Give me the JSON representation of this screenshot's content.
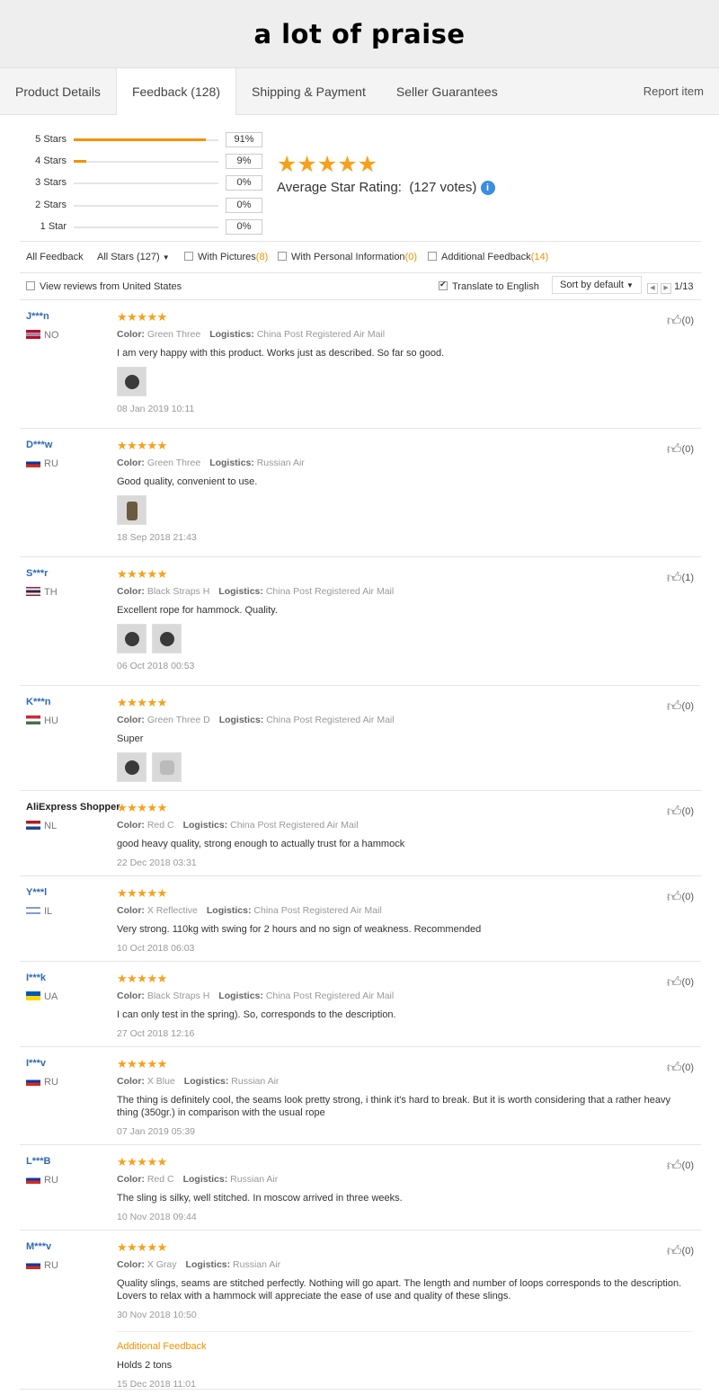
{
  "banner": {
    "title": "a lot of praise"
  },
  "tabs": [
    {
      "label": "Product Details"
    },
    {
      "label": "Feedback (128)"
    },
    {
      "label": "Shipping & Payment"
    },
    {
      "label": "Seller Guarantees"
    }
  ],
  "report_label": "Report item",
  "rating_bars": [
    {
      "label": "5 Stars",
      "pct": "91%",
      "value": 0.91
    },
    {
      "label": "4 Stars",
      "pct": "9%",
      "value": 0.09
    },
    {
      "label": "3 Stars",
      "pct": "0%",
      "value": 0
    },
    {
      "label": "2 Stars",
      "pct": "0%",
      "value": 0
    },
    {
      "label": "1 Star",
      "pct": "0%",
      "value": 0
    }
  ],
  "average": {
    "stars": "★★★★★",
    "label": "Average Star Rating:",
    "votes": "(127 votes)",
    "info_icon": "i"
  },
  "filters": {
    "all_feedback": "All Feedback",
    "all_stars": "All Stars (127)",
    "with_pictures": "With Pictures",
    "with_pictures_count": "(8)",
    "with_personal": "With Personal Information",
    "with_personal_count": "(0)",
    "additional": "Additional Feedback",
    "additional_count": "(14)"
  },
  "sortbar": {
    "view_us": "View reviews from United States",
    "translate": "Translate to English",
    "sort": "Sort by default",
    "page": "1/13"
  },
  "labels": {
    "color": "Color:",
    "logistics": "Logistics:"
  },
  "reviews": [
    {
      "user": "J***n",
      "country": "NO",
      "stars": "★★★★★",
      "color": "Green Three",
      "logistics": "China Post Registered Air Mail",
      "text": "I am very happy with this product. Works just as described. So far so good.",
      "date": "08 Jan 2019 10:11",
      "likes": "(0)"
    },
    {
      "user": "D***w",
      "country": "RU",
      "stars": "★★★★★",
      "color": "Green Three",
      "logistics": "Russian Air",
      "text": "Good quality, convenient to use.",
      "date": "18 Sep 2018 21:43",
      "likes": "(0)"
    },
    {
      "user": "S***r",
      "country": "TH",
      "stars": "★★★★★",
      "color": "Black Straps H",
      "logistics": "China Post Registered Air Mail",
      "text": "Excellent rope for hammock. Quality.",
      "date": "06 Oct 2018 00:53",
      "likes": "(1)"
    },
    {
      "user": "K***n",
      "country": "HU",
      "stars": "★★★★★",
      "color": "Green Three D",
      "logistics": "China Post Registered Air Mail",
      "text": "Super",
      "date": "",
      "likes": "(0)"
    },
    {
      "user": "AliExpress Shopper",
      "country": "NL",
      "stars": "★★★★★",
      "color": "Red C",
      "logistics": "China Post Registered Air Mail",
      "text": "good heavy quality, strong enough to actually trust for a hammock",
      "date": "22 Dec 2018 03:31",
      "likes": "(0)"
    },
    {
      "user": "Y***l",
      "country": "IL",
      "stars": "★★★★★",
      "color": "X Reflective",
      "logistics": "China Post Registered Air Mail",
      "text": "Very strong. 110kg with swing for 2 hours and no sign of weakness. Recommended",
      "date": "10 Oct 2018 06:03",
      "likes": "(0)"
    },
    {
      "user": "I***k",
      "country": "UA",
      "stars": "★★★★★",
      "color": "Black Straps H",
      "logistics": "China Post Registered Air Mail",
      "text": "I can only test in the spring). So, corresponds to the description.",
      "date": "27 Oct 2018 12:16",
      "likes": "(0)"
    },
    {
      "user": "I***v",
      "country": "RU",
      "stars": "★★★★★",
      "color": "X Blue",
      "logistics": "Russian Air",
      "text": "The thing is definitely cool, the seams look pretty strong, i think it's hard to break. But it is worth considering that a rather heavy thing (350gr.) in comparison with the usual rope",
      "date": "07 Jan 2019 05:39",
      "likes": "(0)"
    },
    {
      "user": "L***B",
      "country": "RU",
      "stars": "★★★★★",
      "color": "Red C",
      "logistics": "Russian Air",
      "text": "The sling is silky, well stitched. In moscow arrived in three weeks.",
      "date": "10 Nov 2018 09:44",
      "likes": "(0)"
    },
    {
      "user": "M***v",
      "country": "RU",
      "stars": "★★★★★",
      "color": "X Gray",
      "logistics": "Russian Air",
      "text": "Quality slings, seams are stitched perfectly. Nothing will go apart. The length and number of loops corresponds to the description. Lovers to relax with a hammock will appreciate the ease of use and quality of these slings.",
      "date": "30 Nov 2018 10:50",
      "likes": "(0)",
      "additional": {
        "title": "Additional Feedback",
        "text": "Holds 2 tons",
        "date": "15 Dec 2018 11:01"
      }
    }
  ],
  "colors": {
    "accent": "#f39200",
    "star": "#f8a01a",
    "link": "#2e6ab3"
  }
}
